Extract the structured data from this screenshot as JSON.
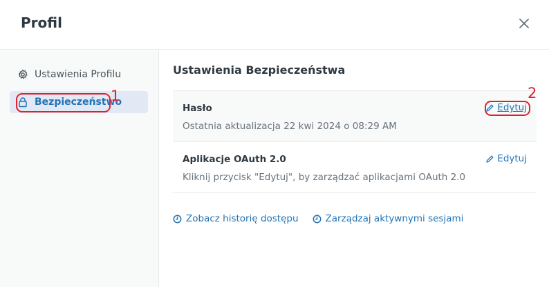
{
  "header": {
    "title": "Profil"
  },
  "sidebar": {
    "items": [
      {
        "label": "Ustawienia Profilu"
      },
      {
        "label": "Bezpieczeństwo"
      }
    ]
  },
  "annotations": {
    "one": "1",
    "two": "2"
  },
  "main": {
    "title": "Ustawienia Bezpieczeństwa",
    "password": {
      "title": "Hasło",
      "description": "Ostatnia aktualizacja 22 kwi 2024 o 08:29 AM",
      "edit_label": "Edytuj"
    },
    "oauth": {
      "title": "Aplikacje OAuth 2.0",
      "description": "Kliknij przycisk \"Edytuj\", by zarządzać aplikacjami OAuth 2.0",
      "edit_label": "Edytuj"
    },
    "links": {
      "history": "Zobacz historię dostępu",
      "sessions": "Zarządzaj aktywnymi sesjami"
    }
  },
  "colors": {
    "accent": "#1f73b7",
    "annotation": "#e0202e",
    "active_bg": "#e2e8f4"
  }
}
